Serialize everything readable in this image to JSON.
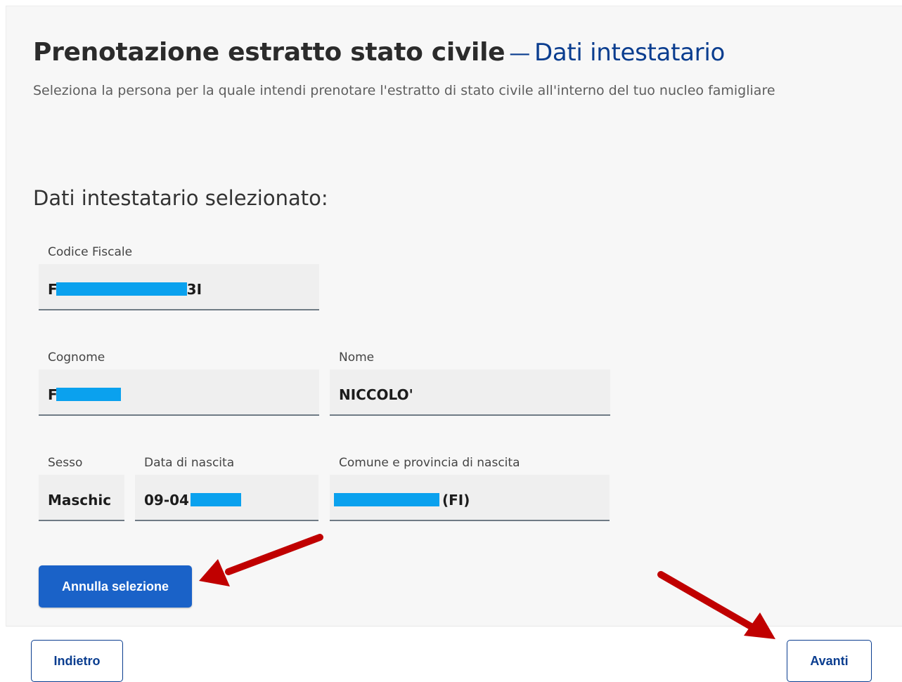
{
  "header": {
    "title": "Prenotazione estratto stato civile",
    "dash": "—",
    "subtitle": "Dati intestatario",
    "description": "Seleziona la persona per la quale intendi prenotare l'estratto di stato civile all'interno del tuo nucleo famigliare"
  },
  "section": {
    "title": "Dati intestatario selezionato:"
  },
  "fields": {
    "codice_fiscale": {
      "label": "Codice Fiscale",
      "prefix": "F",
      "suffix": "3I"
    },
    "cognome": {
      "label": "Cognome",
      "prefix": "F"
    },
    "nome": {
      "label": "Nome",
      "value": "NICCOLO'"
    },
    "sesso": {
      "label": "Sesso",
      "value": "Maschic"
    },
    "data_nascita": {
      "label": "Data di nascita",
      "prefix": "09-04"
    },
    "comune": {
      "label": "Comune e provincia di nascita",
      "suffix": "(FI)"
    }
  },
  "buttons": {
    "annulla": "Annulla selezione",
    "indietro": "Indietro",
    "avanti": "Avanti"
  },
  "colors": {
    "primary": "#1a62c8",
    "title_accent": "#0a3d8f",
    "redaction": "#0aa1ee",
    "annotation_arrow": "#c00000"
  }
}
